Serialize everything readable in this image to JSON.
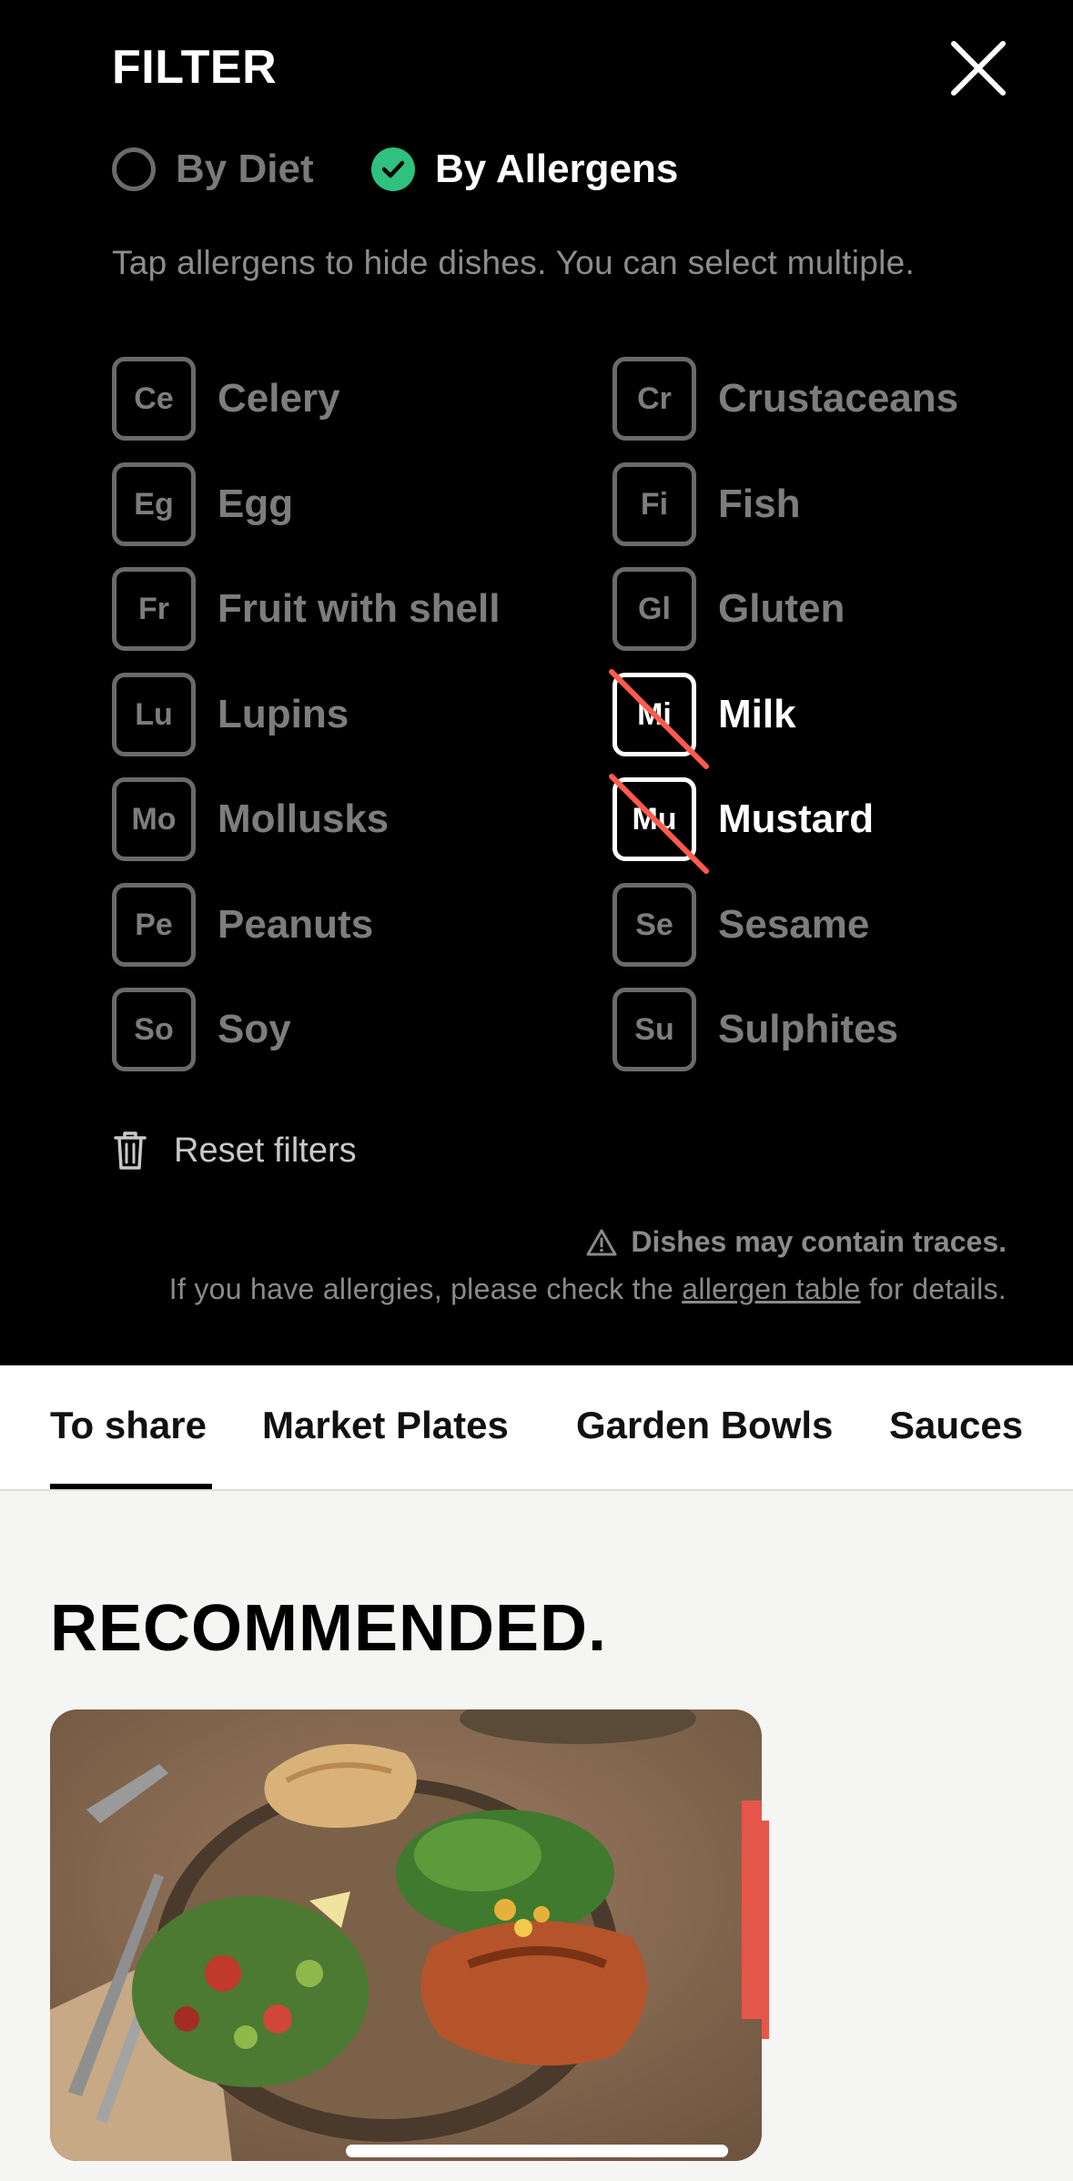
{
  "filter": {
    "title": "FILTER",
    "modes": {
      "diet": "By Diet",
      "allergens": "By Allergens"
    },
    "hint": "Tap allergens to hide dishes. You can select multiple.",
    "allergens": [
      {
        "code": "Ce",
        "label": "Celery",
        "selected": false
      },
      {
        "code": "Cr",
        "label": "Crustaceans",
        "selected": false
      },
      {
        "code": "Eg",
        "label": "Egg",
        "selected": false
      },
      {
        "code": "Fi",
        "label": "Fish",
        "selected": false
      },
      {
        "code": "Fr",
        "label": "Fruit with shell",
        "selected": false
      },
      {
        "code": "Gl",
        "label": "Gluten",
        "selected": false
      },
      {
        "code": "Lu",
        "label": "Lupins",
        "selected": false
      },
      {
        "code": "Mi",
        "label": "Milk",
        "selected": true
      },
      {
        "code": "Mo",
        "label": "Mollusks",
        "selected": false
      },
      {
        "code": "Mu",
        "label": "Mustard",
        "selected": true
      },
      {
        "code": "Pe",
        "label": "Peanuts",
        "selected": false
      },
      {
        "code": "Se",
        "label": "Sesame",
        "selected": false
      },
      {
        "code": "So",
        "label": "Soy",
        "selected": false
      },
      {
        "code": "Su",
        "label": "Sulphites",
        "selected": false
      }
    ],
    "reset_label": "Reset filters",
    "traces_warning": "Dishes may contain traces.",
    "note_before": "If you have allergies, please check the ",
    "note_link": "allergen table",
    "note_after": " for details."
  },
  "tabs": [
    {
      "label": "To share",
      "active": true
    },
    {
      "label": "Market Plates",
      "active": false
    },
    {
      "label": "Garden Bowls",
      "active": false
    },
    {
      "label": "Sauces",
      "active": false
    }
  ],
  "section_title": "RECOMMENDED.",
  "colors": {
    "panel": "#000000",
    "check": "#2ec27e",
    "slash": "#ff5a4d",
    "page": "#f5f5f3"
  },
  "icons": [
    "close-icon",
    "check-icon",
    "trash-icon",
    "warning-icon"
  ]
}
